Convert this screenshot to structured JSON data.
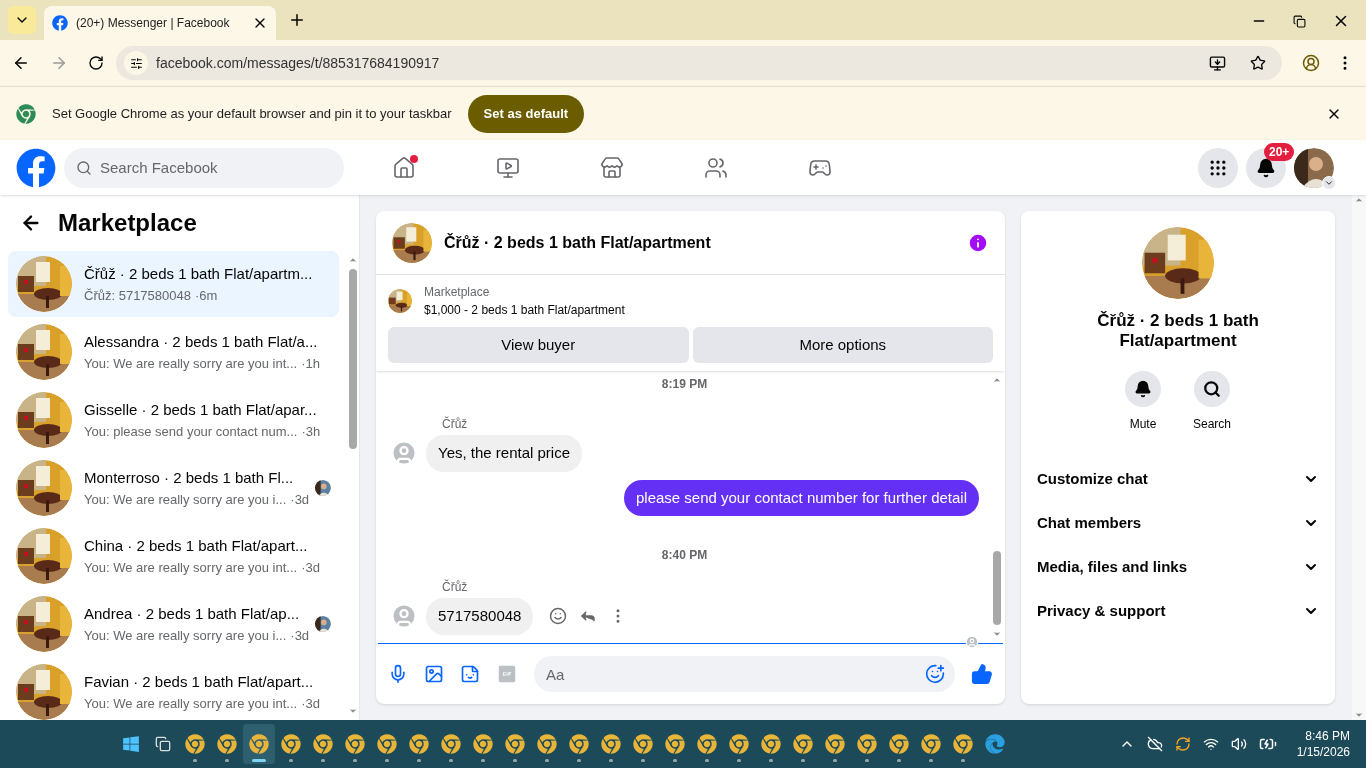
{
  "browser": {
    "tab_title": "(20+) Messenger | Facebook",
    "url": "facebook.com/messages/t/885317684190917",
    "infobar": {
      "message": "Set Google Chrome as your default browser and pin it to your taskbar",
      "button": "Set as default"
    }
  },
  "header": {
    "search_placeholder": "Search Facebook",
    "nav": [
      {
        "kind": "home",
        "dot": true
      },
      {
        "kind": "video",
        "dot": false
      },
      {
        "kind": "marketplace",
        "dot": false
      },
      {
        "kind": "groups",
        "dot": false
      },
      {
        "kind": "gaming",
        "dot": false
      }
    ],
    "notification_badge": "20+"
  },
  "sidebar": {
    "title": "Marketplace",
    "conversations": [
      {
        "title": "Čřůž · 2 beds 1 bath Flat/apartm...",
        "preview": "Čřůž: 5717580048",
        "time": "·6m",
        "selected": true,
        "seen_by": false
      },
      {
        "title": "Alessandra · 2 beds 1 bath Flat/a...",
        "preview": "You: We are really sorry are you int...",
        "time": "·1h",
        "selected": false,
        "seen_by": false
      },
      {
        "title": "Gisselle · 2 beds 1 bath Flat/apar...",
        "preview": "You: please send your contact num...",
        "time": "·3h",
        "selected": false,
        "seen_by": false
      },
      {
        "title": "Monterroso · 2 beds 1 bath Fl...",
        "preview": "You: We are really sorry are you i...",
        "time": "·3d",
        "selected": false,
        "seen_by": true
      },
      {
        "title": "China · 2 beds 1 bath Flat/apart...",
        "preview": "You: We are really sorry are you int...",
        "time": "·3d",
        "selected": false,
        "seen_by": false
      },
      {
        "title": "Andrea · 2 beds 1 bath Flat/ap...",
        "preview": "You: We are really sorry are you i...",
        "time": "·3d",
        "selected": false,
        "seen_by": true
      },
      {
        "title": "Favian · 2 beds 1 bath Flat/apart...",
        "preview": "You: We are really sorry are you int...",
        "time": "·3d",
        "selected": false,
        "seen_by": false
      }
    ]
  },
  "chat": {
    "title": "Čřůž · 2 beds 1 bath Flat/apartment",
    "listing_label": "Marketplace",
    "listing": "$1,000 - 2 beds 1 bath Flat/apartment",
    "buttons": [
      "View buyer",
      "More options"
    ],
    "messages": [
      {
        "kind": "timestamp",
        "text": "8:19 PM"
      },
      {
        "kind": "incoming",
        "sender": "Čřůž",
        "text": "Yes, the rental price",
        "actions": false
      },
      {
        "kind": "outgoing",
        "text": "please send your contact number for further detail"
      },
      {
        "kind": "timestamp",
        "text": "8:40 PM"
      },
      {
        "kind": "incoming",
        "sender": "Čřůž",
        "text": "5717580048",
        "actions": true
      }
    ],
    "composer_placeholder": "Aa"
  },
  "details": {
    "title": "Čřůž · 2 beds 1 bath Flat/apartment",
    "actions": [
      {
        "kind": "mute",
        "label": "Mute"
      },
      {
        "kind": "search",
        "label": "Search"
      }
    ],
    "sections": [
      {
        "label": "Customize chat",
        "expanded": false
      },
      {
        "label": "Chat members",
        "expanded": false
      },
      {
        "label": "Media, files and links",
        "expanded": false
      },
      {
        "label": "Privacy & support",
        "expanded": false
      }
    ]
  },
  "taskbar": {
    "apps": [
      {
        "kind": "start",
        "selected": false
      },
      {
        "kind": "taskview",
        "selected": false
      },
      {
        "kind": "chrome",
        "selected": false
      },
      {
        "kind": "chrome",
        "selected": false
      },
      {
        "kind": "chrome",
        "selected": true
      },
      {
        "kind": "chrome",
        "selected": false
      },
      {
        "kind": "chrome",
        "selected": false
      },
      {
        "kind": "chrome",
        "selected": false
      },
      {
        "kind": "chrome",
        "selected": false
      },
      {
        "kind": "chrome",
        "selected": false
      },
      {
        "kind": "chrome",
        "selected": false
      },
      {
        "kind": "chrome",
        "selected": false
      },
      {
        "kind": "chrome",
        "selected": false
      },
      {
        "kind": "chrome",
        "selected": false
      },
      {
        "kind": "chrome",
        "selected": false
      },
      {
        "kind": "chrome",
        "selected": false
      },
      {
        "kind": "chrome",
        "selected": false
      },
      {
        "kind": "chrome",
        "selected": false
      },
      {
        "kind": "chrome",
        "selected": false
      },
      {
        "kind": "chrome",
        "selected": false
      },
      {
        "kind": "chrome",
        "selected": false
      },
      {
        "kind": "chrome",
        "selected": false
      },
      {
        "kind": "chrome",
        "selected": false
      },
      {
        "kind": "chrome",
        "selected": false
      },
      {
        "kind": "chrome",
        "selected": false
      },
      {
        "kind": "chrome",
        "selected": false
      },
      {
        "kind": "chrome",
        "selected": false
      },
      {
        "kind": "edge",
        "selected": false
      }
    ],
    "time": "8:46 PM",
    "date": "1/15/2026"
  }
}
